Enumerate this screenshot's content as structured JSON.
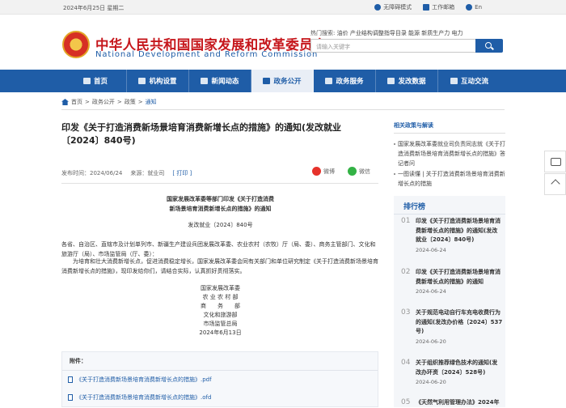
{
  "topbar": {
    "date": "2024年6月25日 星期二",
    "links": [
      {
        "label": "无障碍模式",
        "icon": "accessibility-icon"
      },
      {
        "label": "工作邮箱",
        "icon": "mail-icon"
      },
      {
        "label": "En",
        "icon": "language-icon"
      }
    ]
  },
  "header": {
    "title_cn": "中华人民共和国国家发展和改革委员会",
    "title_en": "National Development and Reform Commission",
    "hot_label": "热门搜索:",
    "hot_terms": "油价  产业结构调整指导目录  能源  新质生产力  电力",
    "search_placeholder": "请输入关键字"
  },
  "nav": [
    {
      "label": "首页",
      "icon": "home-icon"
    },
    {
      "label": "机构设置",
      "icon": "building-icon"
    },
    {
      "label": "新闻动态",
      "icon": "news-icon"
    },
    {
      "label": "政务公开",
      "icon": "document-icon",
      "active": true
    },
    {
      "label": "政务服务",
      "icon": "service-icon"
    },
    {
      "label": "发改数据",
      "icon": "chart-icon"
    },
    {
      "label": "互动交流",
      "icon": "chat-icon"
    }
  ],
  "breadcrumb": {
    "items": [
      "首页",
      "政务公开",
      "政策"
    ],
    "current": "通知",
    "sep": ">"
  },
  "article": {
    "title": "印发《关于打造消费新场景培育消费新增长点的措施》的通知(发改就业〔2024〕840号)",
    "publish_label": "发布时间：",
    "publish_date": "2024/06/24",
    "source_label": "来源：",
    "source": "就业司",
    "print_label": "[ 打印 ]",
    "share_weibo": "微博",
    "share_wechat": "微信",
    "doc_heading_1": "国家发展改革委等部门印发《关于打造消费",
    "doc_heading_2": "新场景培育消费新增长点的措施》的通知",
    "doc_number": "发改就业〔2024〕840号",
    "recipients": "各省、自治区、直辖市及计划单列市、新疆生产建设兵团发展改革委、农业农村（农牧）厅（局、委）、商务主管部门、文化和旅游厅（局）、市场监管局（厅、委）：",
    "body": "为培育和壮大消费新增长点，促进消费稳定增长，国家发展改革委会同有关部门和单位研究制定《关于打造消费新场景培育消费新增长点的措施》，现印发给你们，请结合实际，认真抓好贯彻落实。",
    "signers": [
      "国家发展改革委",
      "农 业 农 村 部",
      "商　　务　　部",
      "文化和旅游部",
      "市场监管总局",
      "2024年6月13日"
    ],
    "attachment_label": "附件：",
    "attachments": [
      "《关于打造消费新场景培育消费新增长点的措施》.pdf",
      "《关于打造消费新场景培育消费新增长点的措施》.ofd"
    ]
  },
  "sidebar": {
    "related_title": "相关政策与解读",
    "related": [
      "国家发展改革委就业司负责同志就《关于打造消费新场景培育消费新增长点的措施》答记者问",
      "一图读懂 | 关于打造消费新场景培育消费新增长点的措施"
    ],
    "rank_title": "排行榜",
    "rank": [
      {
        "num": "01",
        "title": "印发《关于打造消费新场景培育消费新增长点的措施》的通知(发改就业〔2024〕840号)",
        "date": "2024-06-24"
      },
      {
        "num": "02",
        "title": "印发《关于打造消费新场景培育消费新增长点的措施》的通知",
        "date": "2024-06-24"
      },
      {
        "num": "03",
        "title": "关于规范电动自行车充电收费行为的通知(发改办价格〔2024〕537号)",
        "date": "2024-06-20"
      },
      {
        "num": "04",
        "title": "关于组织推荐绿色技术的通知(发改办环资〔2024〕528号)",
        "date": "2024-06-20"
      },
      {
        "num": "05",
        "title": "《天然气利用管理办法》2024年",
        "date": ""
      }
    ]
  },
  "colors": {
    "brand_blue": "#1f5da7",
    "brand_red": "#c6171c"
  }
}
